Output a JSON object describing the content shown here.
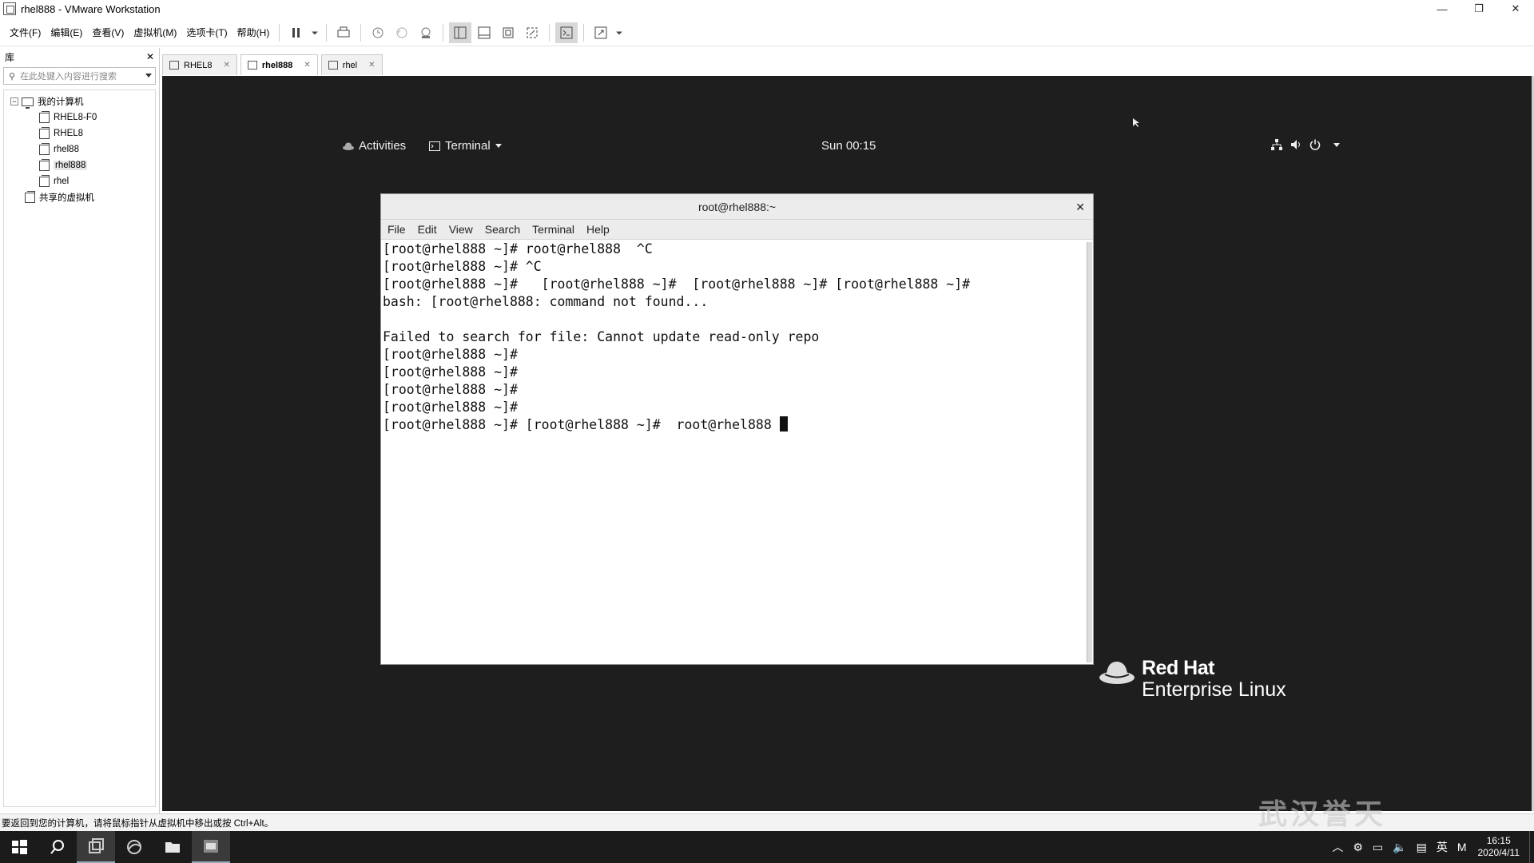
{
  "window": {
    "title": "rhel888 - VMware Workstation"
  },
  "menubar": {
    "items": [
      "文件(F)",
      "编辑(E)",
      "查看(V)",
      "虚拟机(M)",
      "选项卡(T)",
      "帮助(H)"
    ]
  },
  "library": {
    "title": "库",
    "close": "✕",
    "search_placeholder": "在此处键入内容进行搜索",
    "root_label": "我的计算机",
    "vms": [
      {
        "label": "RHEL8-F0"
      },
      {
        "label": "RHEL8"
      },
      {
        "label": "rhel88"
      },
      {
        "label": "rhel888"
      },
      {
        "label": "rhel"
      }
    ],
    "shared_label": "共享的虚拟机"
  },
  "tabs": [
    {
      "label": "RHEL8"
    },
    {
      "label": "rhel888"
    },
    {
      "label": "rhel"
    }
  ],
  "gnome": {
    "activities": "Activities",
    "app_menu": "Terminal",
    "clock": "Sun 00:15"
  },
  "terminal": {
    "title": "root@rhel888:~",
    "menu": [
      "File",
      "Edit",
      "View",
      "Search",
      "Terminal",
      "Help"
    ],
    "lines": [
      "[root@rhel888 ~]# root@rhel888  ^C",
      "[root@rhel888 ~]# ^C",
      "[root@rhel888 ~]#   [root@rhel888 ~]#  [root@rhel888 ~]# [root@rhel888 ~]#",
      "bash: [root@rhel888: command not found...",
      "",
      "Failed to search for file: Cannot update read-only repo",
      "[root@rhel888 ~]#",
      "[root@rhel888 ~]#",
      "[root@rhel888 ~]#",
      "[root@rhel888 ~]#",
      "[root@rhel888 ~]# [root@rhel888 ~]#  root@rhel888 "
    ]
  },
  "branding": {
    "line1": "Red Hat",
    "line2": "Enterprise Linux"
  },
  "statusbar": {
    "text": "要返回到您的计算机，请将鼠标指针从虚拟机中移出或按 Ctrl+Alt。"
  },
  "watermark": "武汉誉天",
  "taskbar": {
    "time": "16:15",
    "date": "2020/4/11",
    "ime": "英",
    "ime2": "M"
  }
}
